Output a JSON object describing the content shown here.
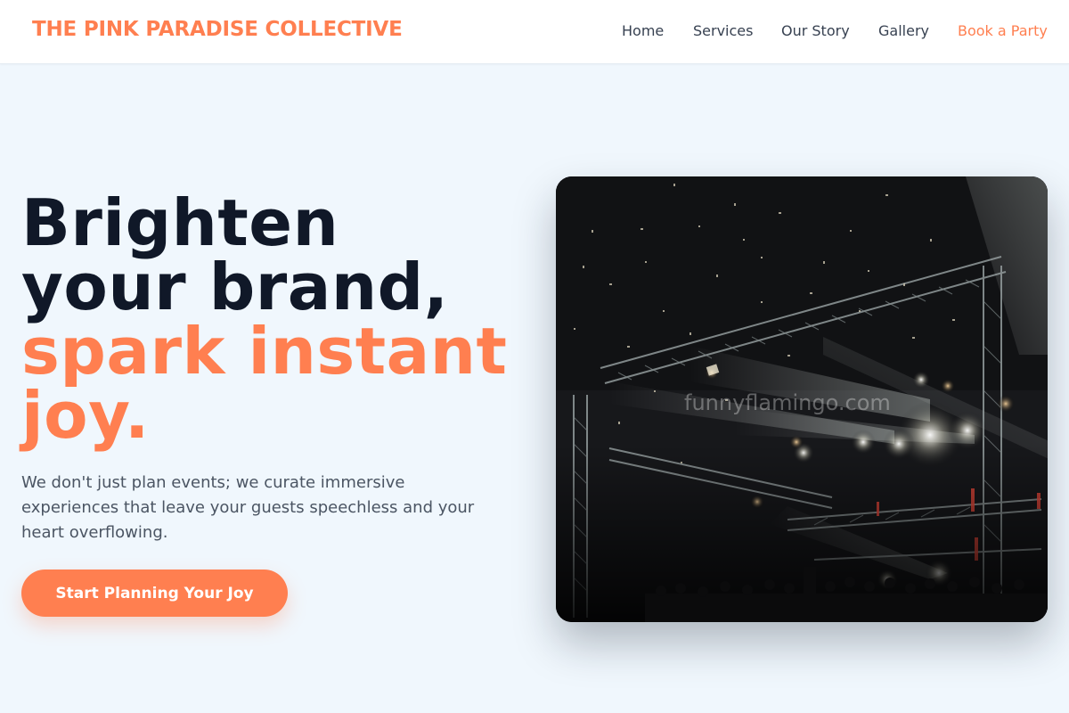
{
  "header": {
    "brand": "THE PINK PARADISE COLLECTIVE",
    "nav": [
      {
        "label": "Home"
      },
      {
        "label": "Services"
      },
      {
        "label": "Our Story"
      },
      {
        "label": "Gallery"
      },
      {
        "label": "Book a Party"
      }
    ]
  },
  "hero": {
    "title_line1": "Brighten",
    "title_line2": "your brand,",
    "title_accent1": "spark instant",
    "title_accent2": "joy.",
    "subtitle": "We don't just plan events; we curate immersive experiences that leave your guests speechless and your heart overflowing.",
    "cta_label": "Start Planning Your Joy"
  },
  "image": {
    "watermark": "funnyflamingo.com"
  },
  "colors": {
    "accent": "#ff7f50",
    "heading": "#101828",
    "body_text": "#4b5563",
    "page_bg": "#f0f7fd"
  }
}
